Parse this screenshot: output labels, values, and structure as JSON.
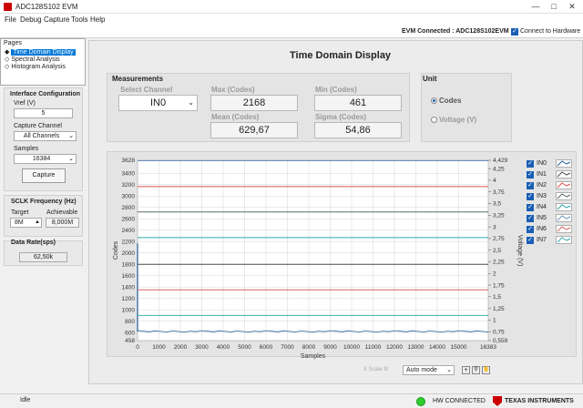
{
  "window": {
    "title": "ADC128S102 EVM",
    "min_glyph": "—",
    "max_glyph": "□",
    "close_glyph": "✕"
  },
  "menu": [
    "File",
    "Debug",
    "Capture",
    "Tools",
    "Help"
  ],
  "status_top": {
    "evm_connected": "EVM Connected : ADC128S102EVM",
    "connect_label": "Connect to Hardware"
  },
  "pages": {
    "header": "Pages",
    "items": [
      "Time Domain Display",
      "Spectral Analysis",
      "Histogram Analysis"
    ],
    "selected": 0
  },
  "interface": {
    "title": "Interface Configuration",
    "vref_label": "Vref (V)",
    "vref_value": "5",
    "capture_channel_label": "Capture Channel",
    "capture_channel_value": "All Channels",
    "samples_label": "Samples",
    "samples_value": "16384",
    "capture_button": "Capture"
  },
  "sclk": {
    "title": "SCLK Frequency (Hz)",
    "target_label": "Target",
    "achievable_label": "Achievable",
    "target_value": "8M",
    "achievable_value": "8,000M"
  },
  "data_rate": {
    "title": "Data Rate(sps)",
    "value": "62,50k"
  },
  "main": {
    "title": "Time Domain Display"
  },
  "measurements": {
    "title": "Measurements",
    "select_channel_label": "Select Channel",
    "select_channel_value": "IN0",
    "max_label": "Max (Codes)",
    "max_value": "2168",
    "min_label": "Min (Codes)",
    "min_value": "461",
    "mean_label": "Mean (Codes)",
    "mean_value": "629,67",
    "sigma_label": "Sigma (Codes)",
    "sigma_value": "54,86"
  },
  "unit": {
    "title": "Unit",
    "codes_label": "Codes",
    "voltage_label": "Voltage (V)",
    "selected": "Codes"
  },
  "chart_controls": {
    "xscale_label": "X Scale fit",
    "autoscale_value": "Auto mode"
  },
  "legend": [
    {
      "name": "IN0",
      "color": "#1f5f99"
    },
    {
      "name": "IN1",
      "color": "#4a4a4a"
    },
    {
      "name": "IN2",
      "color": "#e05050"
    },
    {
      "name": "IN3",
      "color": "#5a6a5a"
    },
    {
      "name": "IN4",
      "color": "#2ba8a8"
    },
    {
      "name": "IN5",
      "color": "#6b8fb8"
    },
    {
      "name": "IN6",
      "color": "#d86060"
    },
    {
      "name": "IN7",
      "color": "#3ab0b0"
    }
  ],
  "status_bottom": {
    "state": "Idle",
    "hw_connected": "HW CONNECTED",
    "vendor": "TEXAS INSTRUMENTS"
  },
  "chart_data": {
    "type": "line",
    "xlabel": "Samples",
    "ylabel": "Codes",
    "y2label": "Voltage (V)",
    "xlim": [
      0,
      16383
    ],
    "ylim": [
      458,
      3628
    ],
    "y2lim": [
      0.559,
      4.429
    ],
    "x_ticks": [
      "0",
      "1000",
      "2000",
      "3000",
      "4000",
      "5000",
      "6000",
      "7000",
      "8000",
      "9000",
      "10000",
      "11000",
      "12000",
      "13000",
      "14000",
      "15000",
      "16383"
    ],
    "x_tick_values": [
      0,
      1000,
      2000,
      3000,
      4000,
      5000,
      6000,
      7000,
      8000,
      9000,
      10000,
      11000,
      12000,
      13000,
      14000,
      15000,
      16383
    ],
    "y_ticks": [
      "458",
      "600",
      "800",
      "1000",
      "1200",
      "1400",
      "1600",
      "1800",
      "2000",
      "2200",
      "2400",
      "2600",
      "2800",
      "3000",
      "3200",
      "3400",
      "3628"
    ],
    "y_tick_values": [
      458,
      600,
      800,
      1000,
      1200,
      1400,
      1600,
      1800,
      2000,
      2200,
      2400,
      2600,
      2800,
      3000,
      3200,
      3400,
      3628
    ],
    "y2_ticks": [
      "0,559",
      "0,75",
      "1",
      "1,25",
      "1,5",
      "1,75",
      "2",
      "2,25",
      "2,5",
      "2,75",
      "3",
      "3,25",
      "3,5",
      "3,75",
      "4",
      "4,25",
      "4,429"
    ],
    "y2_tick_values": [
      0.559,
      0.75,
      1,
      1.25,
      1.5,
      1.75,
      2,
      2.25,
      2.5,
      2.75,
      3,
      3.25,
      3.5,
      3.75,
      4,
      4.25,
      4.429
    ],
    "series": [
      {
        "name": "IN0",
        "values": [
          2168,
          620
        ],
        "note_level": 620
      },
      {
        "name": "IN1",
        "values": [
          1798
        ]
      },
      {
        "name": "IN2",
        "values": [
          3165
        ]
      },
      {
        "name": "IN3",
        "values": [
          2720
        ]
      },
      {
        "name": "IN4",
        "values": [
          2270
        ]
      },
      {
        "name": "IN5",
        "values": [
          3620
        ]
      },
      {
        "name": "IN6",
        "values": [
          1350
        ]
      },
      {
        "name": "IN7",
        "values": [
          900
        ]
      }
    ]
  }
}
